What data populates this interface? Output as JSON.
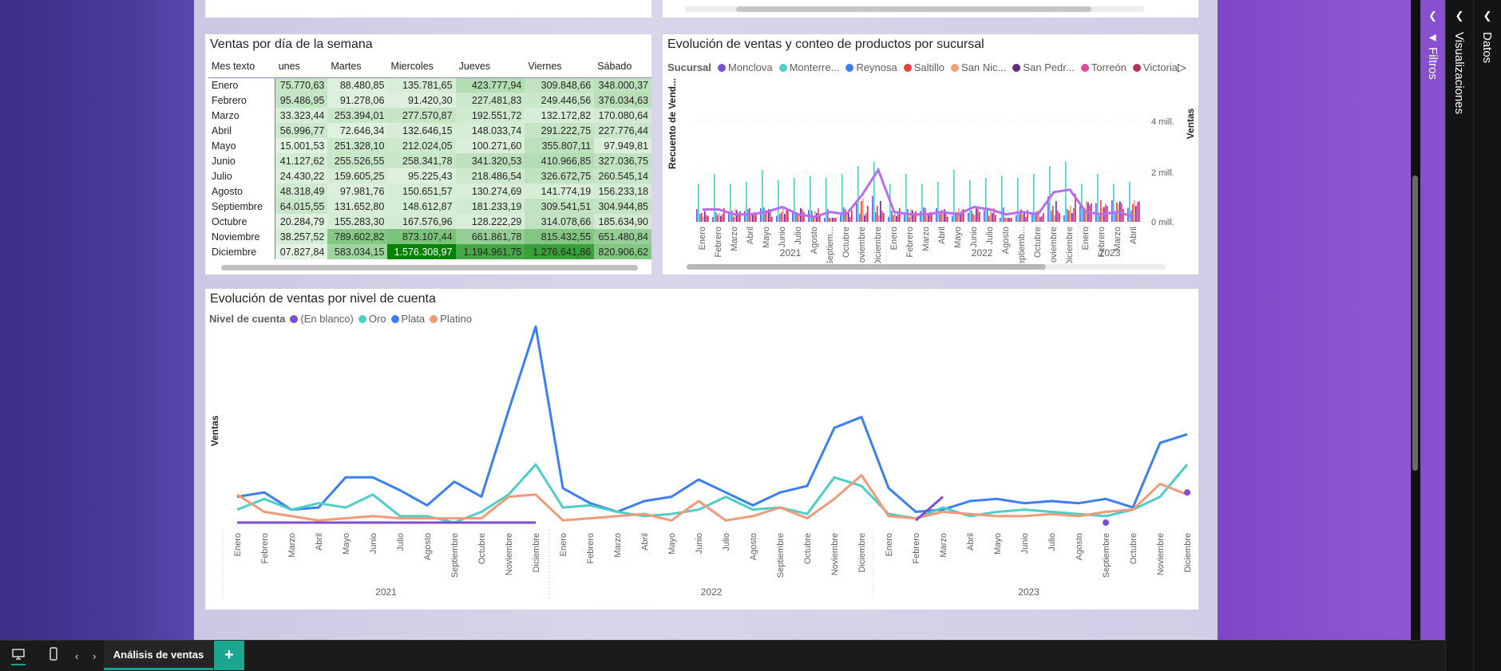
{
  "matrix": {
    "title": "Ventas por día de la semana",
    "columns": [
      "Mes texto",
      "unes",
      "Martes",
      "Miercoles",
      "Jueves",
      "Viernes",
      "Sábado"
    ],
    "rows": [
      {
        "label": "Enero",
        "values": [
          "75.770,63",
          "88.480,85",
          "135.781,65",
          "423.777,94",
          "309.848,66",
          "348.000,37"
        ]
      },
      {
        "label": "Febrero",
        "values": [
          "95.486,95",
          "91.278,06",
          "91.420,30",
          "227.481,83",
          "249.446,56",
          "376.034,63"
        ]
      },
      {
        "label": "Marzo",
        "values": [
          "33.323,44",
          "253.394,01",
          "277.570,87",
          "192.551,72",
          "132.172,82",
          "170.080,64"
        ]
      },
      {
        "label": "Abril",
        "values": [
          "56.996,77",
          "72.646,34",
          "132.646,15",
          "148.033,74",
          "291.222,75",
          "227.776,44"
        ]
      },
      {
        "label": "Mayo",
        "values": [
          "15.001,53",
          "251.328,10",
          "212.024,05",
          "100.271,60",
          "355.807,11",
          "97.949,81"
        ]
      },
      {
        "label": "Junio",
        "values": [
          "41.127,62",
          "255.526,55",
          "258.341,78",
          "341.320,53",
          "410.966,85",
          "327.036,75"
        ]
      },
      {
        "label": "Julio",
        "values": [
          "24.430,22",
          "159.605,25",
          "95.225,43",
          "218.486,54",
          "326.672,75",
          "260.545,14"
        ]
      },
      {
        "label": "Agosto",
        "values": [
          "48.318,49",
          "97.981,76",
          "150.651,57",
          "130.274,69",
          "141.774,19",
          "156.233,18"
        ]
      },
      {
        "label": "Septiembre",
        "values": [
          "64.015,55",
          "131.652,80",
          "148.612,87",
          "181.233,19",
          "309.541,51",
          "304.944,85"
        ]
      },
      {
        "label": "Octubre",
        "values": [
          "20.284,79",
          "155.283,30",
          "167.576,96",
          "128.222,29",
          "314.078,66",
          "185.634,90"
        ]
      },
      {
        "label": "Noviembre",
        "values": [
          "38.257,52",
          "789.602,82",
          "873.107,44",
          "661.861,78",
          "815.432,55",
          "651.480,84"
        ]
      },
      {
        "label": "Diciembre",
        "values": [
          "07.827,84",
          "583.034,15",
          "1.576.308,97",
          "1.194.961,75",
          "1.276.641,86",
          "820.906,62"
        ]
      }
    ]
  },
  "branch_chart": {
    "title": "Evolución de ventas y conteo de productos por sucursal",
    "legend_title": "Sucursal",
    "legend": [
      {
        "name": "Monclova",
        "color": "#7b4fd0"
      },
      {
        "name": "Monterre...",
        "color": "#4fcec6"
      },
      {
        "name": "Reynosa",
        "color": "#3c7ff0"
      },
      {
        "name": "Saltillo",
        "color": "#e0483f"
      },
      {
        "name": "San Nic...",
        "color": "#f19a7a"
      },
      {
        "name": "San Pedr...",
        "color": "#6a2a7a"
      },
      {
        "name": "Torreón",
        "color": "#e04a9a"
      },
      {
        "name": "Victoria",
        "color": "#b8325e"
      }
    ],
    "y_left_label": "Recuento de Vend...",
    "y_right_label": "Ventas",
    "y_right_ticks": [
      "4 mill.",
      "2 mill.",
      "0 mill."
    ],
    "months": [
      "Enero",
      "Febrero",
      "Marzo",
      "Abril",
      "Mayo",
      "Junio",
      "Julio",
      "Agosto",
      "Septiem...",
      "Octubre",
      "Noviembre",
      "Diciembre",
      "Enero",
      "Febrero",
      "Marzo",
      "Abril",
      "Mayo",
      "Junio",
      "Julio",
      "Agosto",
      "Septiemb...",
      "Octubre",
      "Noviembre",
      "Diciembre",
      "Enero",
      "Febrero",
      "Marzo",
      "Abril"
    ],
    "years": [
      "2021",
      "2022",
      "2023"
    ]
  },
  "line_chart": {
    "title": "Evolución de ventas por nivel de cuenta",
    "legend_title": "Nivel de cuenta",
    "legend": [
      {
        "name": "(En blanco)",
        "color": "#7b4fd0"
      },
      {
        "name": "Oro",
        "color": "#4fcec6"
      },
      {
        "name": "Plata",
        "color": "#3c7ff0"
      },
      {
        "name": "Platino",
        "color": "#f19a7a"
      }
    ],
    "y_label": "Ventas",
    "months": [
      "Enero",
      "Febrero",
      "Marzo",
      "Abril",
      "Mayo",
      "Junio",
      "Julio",
      "Agosto",
      "Septiembre",
      "Octubre",
      "Noviembre",
      "Diciembre",
      "Enero",
      "Febrero",
      "Marzo",
      "Abril",
      "Mayo",
      "Junio",
      "Julio",
      "Agosto",
      "Septiembre",
      "Octubre",
      "Noviembre",
      "Diciembre",
      "Enero",
      "Febrero",
      "Marzo",
      "Abril",
      "Mayo",
      "Junio",
      "Julio",
      "Agosto",
      "Septiembre",
      "Octubre",
      "Noviembre",
      "Diciembre"
    ],
    "years": [
      "2021",
      "2022",
      "2023"
    ]
  },
  "chart_data": [
    {
      "type": "line",
      "title": "Evolución de ventas por nivel de cuenta",
      "xlabel": "",
      "ylabel": "Ventas",
      "x": [
        "2021-01",
        "2021-02",
        "2021-03",
        "2021-04",
        "2021-05",
        "2021-06",
        "2021-07",
        "2021-08",
        "2021-09",
        "2021-10",
        "2021-11",
        "2021-12",
        "2022-01",
        "2022-02",
        "2022-03",
        "2022-04",
        "2022-05",
        "2022-06",
        "2022-07",
        "2022-08",
        "2022-09",
        "2022-10",
        "2022-11",
        "2022-12",
        "2023-01",
        "2023-02",
        "2023-03",
        "2023-04",
        "2023-05",
        "2023-06",
        "2023-07",
        "2023-08",
        "2023-09",
        "2023-10",
        "2023-11",
        "2023-12"
      ],
      "ylim": [
        0,
        1
      ],
      "series": [
        {
          "name": "Plata",
          "values": [
            0.12,
            0.14,
            0.06,
            0.07,
            0.21,
            0.21,
            0.15,
            0.08,
            0.19,
            0.12,
            0.52,
            0.91,
            0.16,
            0.09,
            0.05,
            0.1,
            0.12,
            0.2,
            0.14,
            0.08,
            0.14,
            0.17,
            0.44,
            0.49,
            0.16,
            0.05,
            0.06,
            0.1,
            0.11,
            0.09,
            0.1,
            0.09,
            0.11,
            0.07,
            0.37,
            0.41
          ]
        },
        {
          "name": "Oro",
          "values": [
            0.06,
            0.11,
            0.06,
            0.09,
            0.07,
            0.13,
            0.03,
            0.03,
            0.0,
            0.05,
            0.13,
            0.27,
            0.07,
            0.08,
            0.05,
            0.03,
            0.04,
            0.06,
            0.12,
            0.06,
            0.07,
            0.04,
            0.21,
            0.17,
            0.04,
            0.02,
            0.07,
            0.03,
            0.05,
            0.06,
            0.05,
            0.04,
            0.03,
            0.06,
            0.12,
            0.27
          ]
        },
        {
          "name": "Platino",
          "values": [
            0.13,
            0.05,
            0.03,
            0.01,
            0.02,
            0.03,
            0.02,
            0.02,
            0.02,
            0.02,
            0.12,
            0.13,
            0.01,
            0.02,
            0.03,
            0.04,
            0.01,
            0.1,
            0.01,
            0.03,
            0.07,
            0.02,
            0.11,
            0.22,
            0.03,
            0.02,
            0.05,
            0.04,
            0.03,
            0.03,
            0.04,
            0.03,
            0.05,
            0.06,
            0.18,
            0.13
          ]
        },
        {
          "name": "(En blanco)",
          "values": [
            0,
            0,
            0,
            0,
            0,
            0,
            0,
            0,
            0,
            0,
            0,
            0,
            null,
            null,
            null,
            null,
            null,
            null,
            null,
            null,
            null,
            null,
            null,
            null,
            null,
            0.01,
            0.12,
            null,
            null,
            null,
            null,
            null,
            0,
            null,
            null,
            0.14
          ]
        }
      ]
    }
  ]
}
